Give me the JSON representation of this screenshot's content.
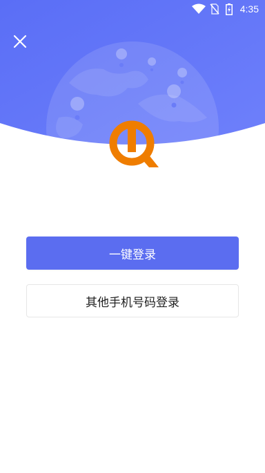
{
  "status_bar": {
    "time": "4:35",
    "icons": [
      "wifi-icon",
      "no-sim-icon",
      "battery-charging-icon"
    ]
  },
  "header": {
    "close_icon": "close-icon",
    "background_illustration": "globe-with-location-pins",
    "gradient_colors": [
      "#5a6ef6",
      "#7b8bff"
    ]
  },
  "logo": {
    "icon": "app-logo-icon",
    "color": "#ef7d00"
  },
  "actions": {
    "one_click_login": "一键登录",
    "other_phone_login": "其他手机号码登录"
  },
  "colors": {
    "primary_button": "#5b6df0",
    "secondary_border": "#e6e6e6"
  }
}
